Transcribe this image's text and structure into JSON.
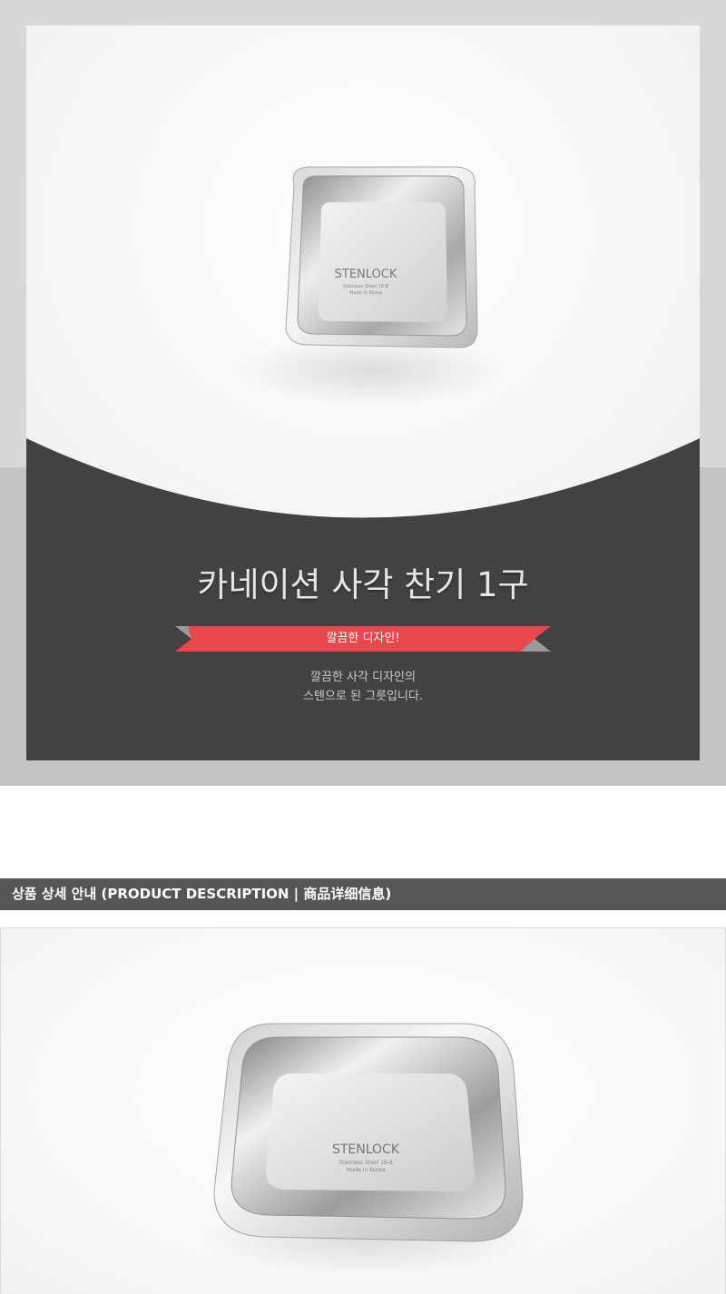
{
  "hero": {
    "title": "카네이션 사각 찬기 1구",
    "ribbon_label": "깔끔한 디자인!",
    "description_lines": [
      "깔끔한 사각 디자인의",
      "스텐으로 된 그릇입니다."
    ],
    "product_logo": "STENLOCK",
    "product_logo_sub1": "Stainless Steel 18-8",
    "product_logo_sub2": "Made in Korea",
    "colors": {
      "dark_panel": "#424242",
      "ribbon": "#e8474b",
      "outer_bg": "#d8d8d8"
    }
  },
  "section": {
    "title": "상품 상세 안내 (PRODUCT DESCRIPTION | 商品详细信息)"
  },
  "detail": {
    "product_logo": "STENLOCK",
    "product_logo_sub1": "Stainless Steel 18-8",
    "product_logo_sub2": "Made in Korea"
  }
}
